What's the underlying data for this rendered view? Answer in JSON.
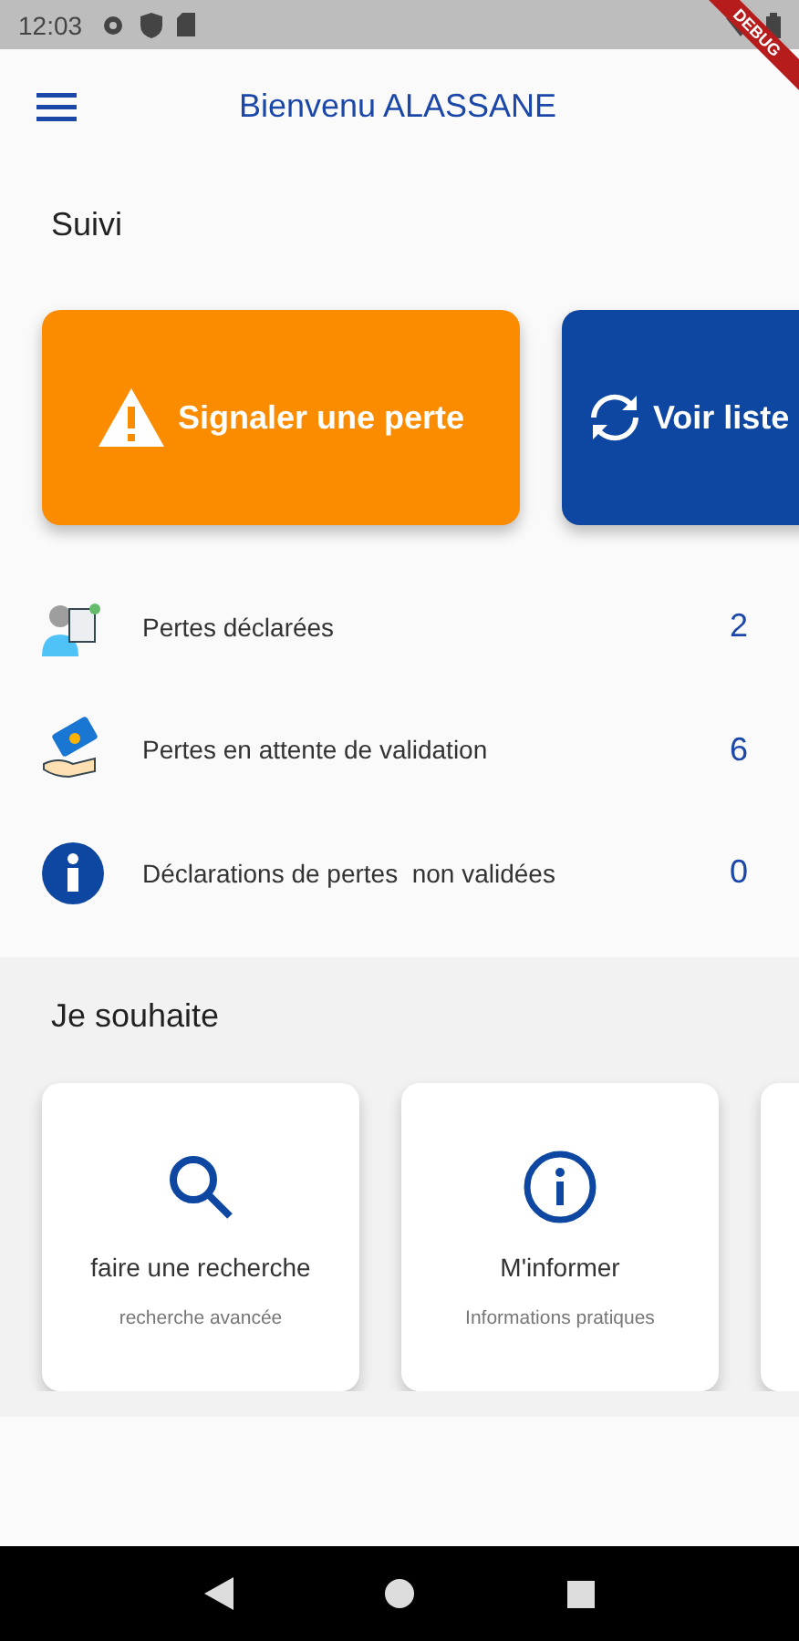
{
  "status_bar": {
    "time": "12:03"
  },
  "debug_banner": {
    "label": "DEBUG"
  },
  "app_bar": {
    "title": "Bienvenu ALASSANE"
  },
  "suivi": {
    "title": "Suivi",
    "actions": [
      {
        "label": "Signaler une perte",
        "kind": "warning"
      },
      {
        "label": "Voir liste",
        "kind": "refresh"
      }
    ],
    "stats": [
      {
        "label": "Pertes déclarées",
        "count": "2",
        "kind": "person"
      },
      {
        "label": "Pertes en attente de validation",
        "count": "6",
        "kind": "hand"
      },
      {
        "label": "Déclarations de pertes  non validées",
        "count": "0",
        "kind": "info"
      }
    ]
  },
  "wishes": {
    "title": "Je souhaite",
    "cards": [
      {
        "title": "faire une recherche",
        "subtitle": "recherche avancée",
        "kind": "search"
      },
      {
        "title": "M'informer",
        "subtitle": "Informations pratiques",
        "kind": "info"
      },
      {
        "kind": "blank"
      }
    ]
  }
}
